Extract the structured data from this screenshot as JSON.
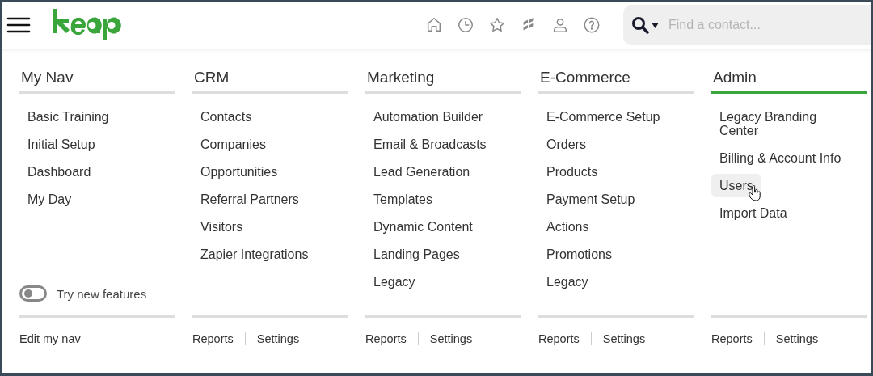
{
  "header": {
    "search": {
      "placeholder": "Find a contact..."
    }
  },
  "columns": [
    {
      "title": "My Nav",
      "selected": false,
      "items": [
        {
          "label": "Basic Training",
          "highlighted": false
        },
        {
          "label": "Initial Setup",
          "highlighted": false
        },
        {
          "label": "Dashboard",
          "highlighted": false
        },
        {
          "label": "My Day",
          "highlighted": false
        }
      ],
      "toggle": {
        "label": "Try new features",
        "on": false
      },
      "footer_links": [
        "Edit my nav"
      ]
    },
    {
      "title": "CRM",
      "selected": false,
      "items": [
        {
          "label": "Contacts",
          "highlighted": false
        },
        {
          "label": "Companies",
          "highlighted": false
        },
        {
          "label": "Opportunities",
          "highlighted": false
        },
        {
          "label": "Referral Partners",
          "highlighted": false
        },
        {
          "label": "Visitors",
          "highlighted": false
        },
        {
          "label": "Zapier Integrations",
          "highlighted": false
        }
      ],
      "footer_links": [
        "Reports",
        "Settings"
      ]
    },
    {
      "title": "Marketing",
      "selected": false,
      "items": [
        {
          "label": "Automation Builder",
          "highlighted": false
        },
        {
          "label": "Email & Broadcasts",
          "highlighted": false
        },
        {
          "label": "Lead Generation",
          "highlighted": false
        },
        {
          "label": "Templates",
          "highlighted": false
        },
        {
          "label": "Dynamic Content",
          "highlighted": false
        },
        {
          "label": "Landing Pages",
          "highlighted": false
        },
        {
          "label": "Legacy",
          "highlighted": false
        }
      ],
      "footer_links": [
        "Reports",
        "Settings"
      ]
    },
    {
      "title": "E-Commerce",
      "selected": false,
      "items": [
        {
          "label": "E-Commerce Setup",
          "highlighted": false
        },
        {
          "label": "Orders",
          "highlighted": false
        },
        {
          "label": "Products",
          "highlighted": false
        },
        {
          "label": "Payment Setup",
          "highlighted": false
        },
        {
          "label": "Actions",
          "highlighted": false
        },
        {
          "label": "Promotions",
          "highlighted": false
        },
        {
          "label": "Legacy",
          "highlighted": false
        }
      ],
      "footer_links": [
        "Reports",
        "Settings"
      ]
    },
    {
      "title": "Admin",
      "selected": true,
      "items": [
        {
          "label": "Legacy Branding Center",
          "highlighted": false
        },
        {
          "label": "Billing & Account Info",
          "highlighted": false
        },
        {
          "label": "Users",
          "highlighted": true
        },
        {
          "label": "Import Data",
          "highlighted": false
        }
      ],
      "footer_links": [
        "Reports",
        "Settings"
      ]
    }
  ]
}
